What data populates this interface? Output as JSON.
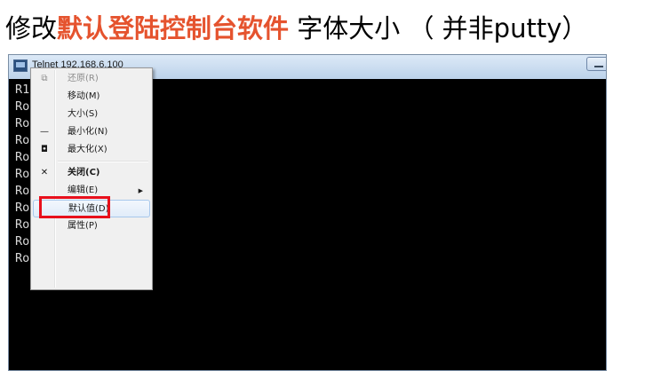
{
  "headline": {
    "prefix": "修改",
    "highlight": "默认登陆控制台软件",
    "suffix": " 字体大小 （ 并非putty）",
    "highlight_color": "#e5532e"
  },
  "window": {
    "title": "Telnet 192.168.6.100"
  },
  "console": {
    "lines": [
      "R1",
      "Ro",
      "Ro",
      "Ro",
      "Ro",
      "Ro",
      "Ro",
      "Ro",
      "Ro",
      "Ro",
      "Router>"
    ]
  },
  "menu": {
    "items": [
      {
        "label": "还原(R)",
        "icon": "restore-icon",
        "glyph": "⧉",
        "disabled": true
      },
      {
        "label": "移动(M)",
        "icon": "",
        "glyph": ""
      },
      {
        "label": "大小(S)",
        "icon": "",
        "glyph": ""
      },
      {
        "label": "最小化(N)",
        "icon": "minimize-icon",
        "glyph": "—"
      },
      {
        "label": "最大化(X)",
        "icon": "maximize-icon",
        "glyph": "◘"
      },
      {
        "label": "关闭(C)",
        "icon": "close-icon",
        "glyph": "✕",
        "bold": true
      },
      {
        "label": "编辑(E)",
        "icon": "",
        "glyph": "",
        "submenu": "▶"
      },
      {
        "label": "默认值(D)",
        "icon": "",
        "glyph": "",
        "highlighted": true
      },
      {
        "label": "属性(P)",
        "icon": "",
        "glyph": ""
      }
    ]
  },
  "annotation": {
    "color": "#e8101c"
  }
}
